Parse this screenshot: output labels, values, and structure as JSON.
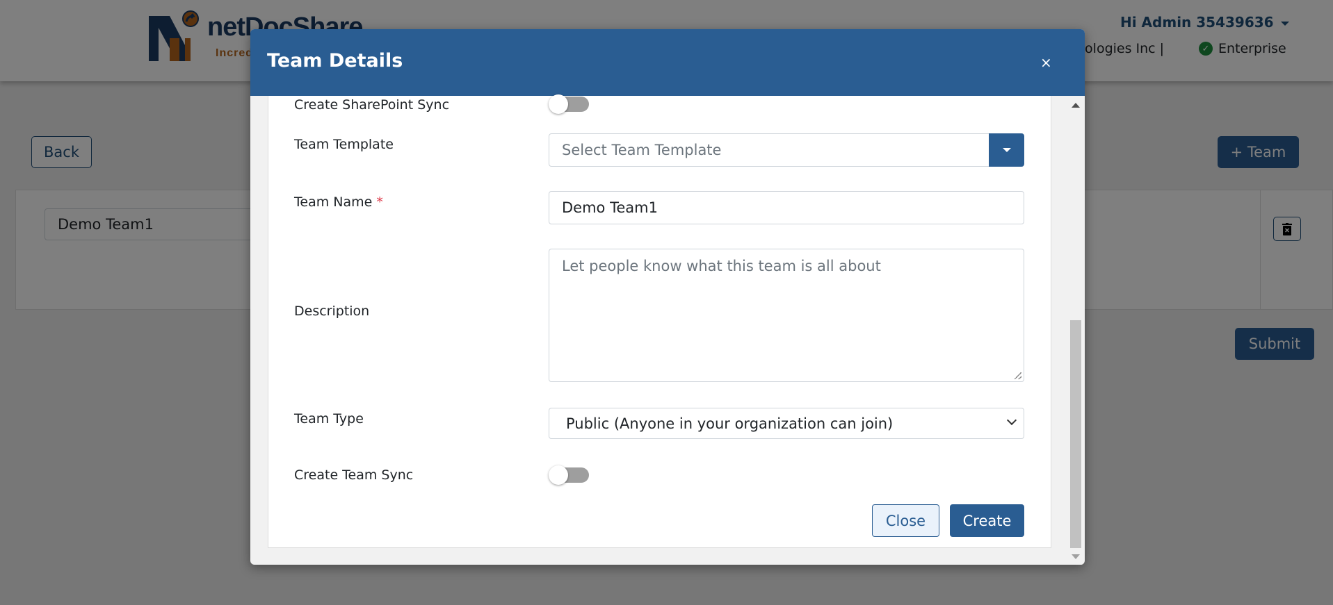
{
  "page": {
    "brand": "netDocShare",
    "tagline": "Incred",
    "greeting": "Hi Admin 35439636",
    "organization": "nologies Inc |",
    "plan": "Enterprise",
    "back_label": "Back",
    "add_team_label": "+ Team",
    "team_row_value": "Demo Team1",
    "submit_label": "Submit"
  },
  "modal": {
    "title": "Team Details",
    "close_glyph": "×",
    "sharepoint_sync_label": "Create SharePoint Sync",
    "sharepoint_sync_on": false,
    "template_label": "Team Template",
    "template_placeholder": "Select Team Template",
    "name_label": "Team Name",
    "required_mark": "*",
    "name_value": "Demo Team1",
    "description_label": "Description",
    "description_placeholder": "Let people know what this team is all about",
    "type_label": "Team Type",
    "type_value": "Public (Anyone in your organization can join)",
    "team_sync_label": "Create Team Sync",
    "team_sync_on": false,
    "close_label": "Close",
    "create_label": "Create"
  },
  "colors": {
    "primary": "#2a5d92",
    "brand_dark": "#1a3a63",
    "brand_orange": "#b5651d",
    "verified": "#1e8e3e"
  }
}
